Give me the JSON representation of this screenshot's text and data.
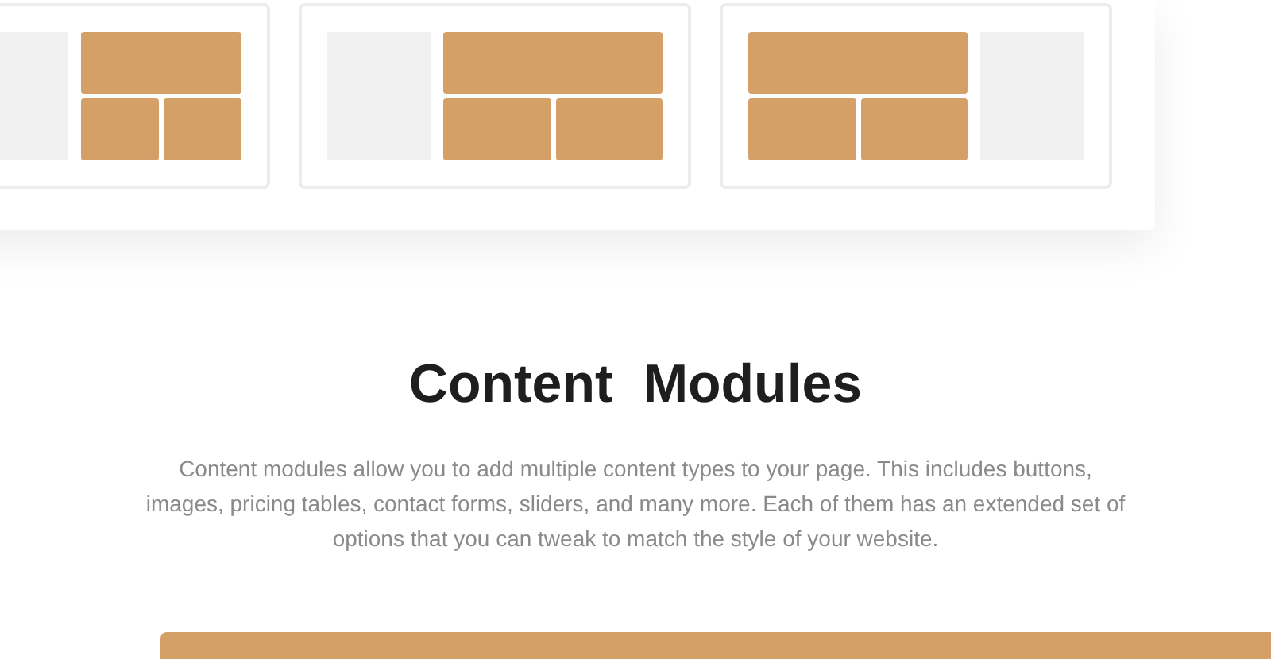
{
  "layouts": [
    {
      "kind": "image-left"
    },
    {
      "kind": "image-left"
    },
    {
      "kind": "image-right"
    }
  ],
  "section": {
    "title": "Content  Modules",
    "description": "Content modules allow you to add multiple content types to your page. This includes buttons, images, pricing tables, contact forms, sliders, and many more. Each of them has an extended set of options that you can tweak to match the style of your website."
  }
}
